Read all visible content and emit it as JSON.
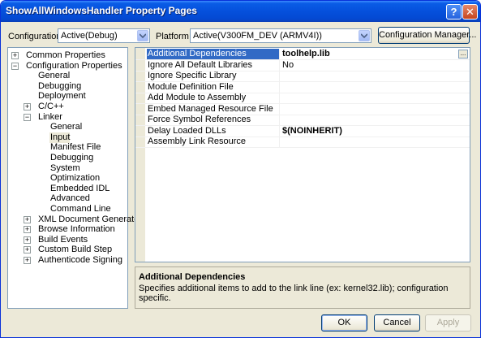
{
  "window": {
    "title": "ShowAllWindowsHandler Property Pages",
    "help_glyph": "?",
    "close_glyph": "✕"
  },
  "toolbar": {
    "configuration_label": "Configuration:",
    "configuration_value": "Active(Debug)",
    "platform_label": "Platform:",
    "platform_value": "Active(V300FM_DEV (ARMV4I))",
    "config_manager_label": "Configuration Manager..."
  },
  "tree": {
    "items": [
      {
        "label": "Common Properties",
        "expander": "+"
      },
      {
        "label": "Configuration Properties",
        "expander": "−"
      },
      {
        "label": "General",
        "expander": ""
      },
      {
        "label": "Debugging",
        "expander": ""
      },
      {
        "label": "Deployment",
        "expander": ""
      },
      {
        "label": "C/C++",
        "expander": "+"
      },
      {
        "label": "Linker",
        "expander": "−"
      },
      {
        "label": "General",
        "expander": ""
      },
      {
        "label": "Input",
        "expander": "",
        "selected": true
      },
      {
        "label": "Manifest File",
        "expander": ""
      },
      {
        "label": "Debugging",
        "expander": ""
      },
      {
        "label": "System",
        "expander": ""
      },
      {
        "label": "Optimization",
        "expander": ""
      },
      {
        "label": "Embedded IDL",
        "expander": ""
      },
      {
        "label": "Advanced",
        "expander": ""
      },
      {
        "label": "Command Line",
        "expander": ""
      },
      {
        "label": "XML Document Generator",
        "expander": "+"
      },
      {
        "label": "Browse Information",
        "expander": "+"
      },
      {
        "label": "Build Events",
        "expander": "+"
      },
      {
        "label": "Custom Build Step",
        "expander": "+"
      },
      {
        "label": "Authenticode Signing",
        "expander": "+"
      }
    ]
  },
  "grid": {
    "rows": [
      {
        "name": "Additional Dependencies",
        "value": "toolhelp.lib",
        "bold": true,
        "selected": true,
        "ellipsis": "..."
      },
      {
        "name": "Ignore All Default Libraries",
        "value": "No",
        "bold": false
      },
      {
        "name": "Ignore Specific Library",
        "value": "",
        "bold": false
      },
      {
        "name": "Module Definition File",
        "value": "",
        "bold": false
      },
      {
        "name": "Add Module to Assembly",
        "value": "",
        "bold": false
      },
      {
        "name": "Embed Managed Resource File",
        "value": "",
        "bold": false
      },
      {
        "name": "Force Symbol References",
        "value": "",
        "bold": false
      },
      {
        "name": "Delay Loaded DLLs",
        "value": "$(NOINHERIT)",
        "bold": true
      },
      {
        "name": "Assembly Link Resource",
        "value": "",
        "bold": false
      }
    ]
  },
  "description": {
    "title": "Additional Dependencies",
    "text": "Specifies additional items to add to the link line (ex: kernel32.lib); configuration specific."
  },
  "buttons": {
    "ok": "OK",
    "cancel": "Cancel",
    "apply": "Apply"
  }
}
